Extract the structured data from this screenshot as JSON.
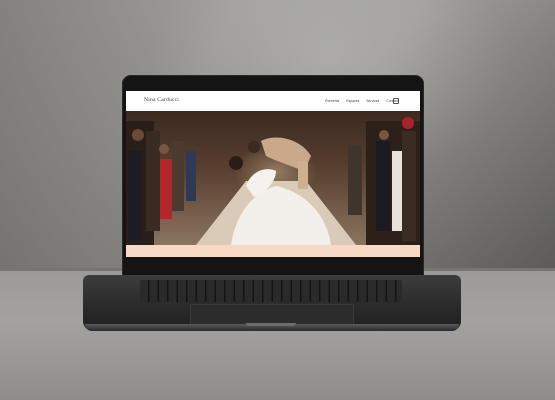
{
  "site": {
    "brand": "Nina Carducci",
    "nav": [
      "Évenents",
      "Espaces",
      "Services",
      "Contact"
    ],
    "hero_caption": "Nina Carducci",
    "accent_color": "#f7d9c6"
  },
  "icons": {
    "cart": "cart-icon"
  }
}
